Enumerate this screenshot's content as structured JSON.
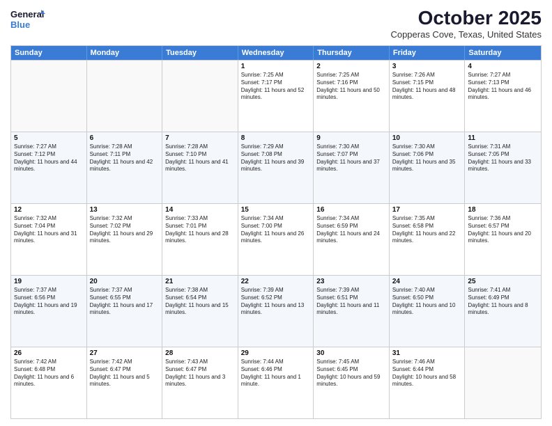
{
  "logo": {
    "line1": "General",
    "line2": "Blue"
  },
  "title": "October 2025",
  "subtitle": "Copperas Cove, Texas, United States",
  "days_of_week": [
    "Sunday",
    "Monday",
    "Tuesday",
    "Wednesday",
    "Thursday",
    "Friday",
    "Saturday"
  ],
  "weeks": [
    [
      {
        "day": "",
        "empty": true
      },
      {
        "day": "",
        "empty": true
      },
      {
        "day": "",
        "empty": true
      },
      {
        "day": "1",
        "sunrise": "Sunrise: 7:25 AM",
        "sunset": "Sunset: 7:17 PM",
        "daylight": "Daylight: 11 hours and 52 minutes."
      },
      {
        "day": "2",
        "sunrise": "Sunrise: 7:25 AM",
        "sunset": "Sunset: 7:16 PM",
        "daylight": "Daylight: 11 hours and 50 minutes."
      },
      {
        "day": "3",
        "sunrise": "Sunrise: 7:26 AM",
        "sunset": "Sunset: 7:15 PM",
        "daylight": "Daylight: 11 hours and 48 minutes."
      },
      {
        "day": "4",
        "sunrise": "Sunrise: 7:27 AM",
        "sunset": "Sunset: 7:13 PM",
        "daylight": "Daylight: 11 hours and 46 minutes."
      }
    ],
    [
      {
        "day": "5",
        "sunrise": "Sunrise: 7:27 AM",
        "sunset": "Sunset: 7:12 PM",
        "daylight": "Daylight: 11 hours and 44 minutes."
      },
      {
        "day": "6",
        "sunrise": "Sunrise: 7:28 AM",
        "sunset": "Sunset: 7:11 PM",
        "daylight": "Daylight: 11 hours and 42 minutes."
      },
      {
        "day": "7",
        "sunrise": "Sunrise: 7:28 AM",
        "sunset": "Sunset: 7:10 PM",
        "daylight": "Daylight: 11 hours and 41 minutes."
      },
      {
        "day": "8",
        "sunrise": "Sunrise: 7:29 AM",
        "sunset": "Sunset: 7:08 PM",
        "daylight": "Daylight: 11 hours and 39 minutes."
      },
      {
        "day": "9",
        "sunrise": "Sunrise: 7:30 AM",
        "sunset": "Sunset: 7:07 PM",
        "daylight": "Daylight: 11 hours and 37 minutes."
      },
      {
        "day": "10",
        "sunrise": "Sunrise: 7:30 AM",
        "sunset": "Sunset: 7:06 PM",
        "daylight": "Daylight: 11 hours and 35 minutes."
      },
      {
        "day": "11",
        "sunrise": "Sunrise: 7:31 AM",
        "sunset": "Sunset: 7:05 PM",
        "daylight": "Daylight: 11 hours and 33 minutes."
      }
    ],
    [
      {
        "day": "12",
        "sunrise": "Sunrise: 7:32 AM",
        "sunset": "Sunset: 7:04 PM",
        "daylight": "Daylight: 11 hours and 31 minutes."
      },
      {
        "day": "13",
        "sunrise": "Sunrise: 7:32 AM",
        "sunset": "Sunset: 7:02 PM",
        "daylight": "Daylight: 11 hours and 29 minutes."
      },
      {
        "day": "14",
        "sunrise": "Sunrise: 7:33 AM",
        "sunset": "Sunset: 7:01 PM",
        "daylight": "Daylight: 11 hours and 28 minutes."
      },
      {
        "day": "15",
        "sunrise": "Sunrise: 7:34 AM",
        "sunset": "Sunset: 7:00 PM",
        "daylight": "Daylight: 11 hours and 26 minutes."
      },
      {
        "day": "16",
        "sunrise": "Sunrise: 7:34 AM",
        "sunset": "Sunset: 6:59 PM",
        "daylight": "Daylight: 11 hours and 24 minutes."
      },
      {
        "day": "17",
        "sunrise": "Sunrise: 7:35 AM",
        "sunset": "Sunset: 6:58 PM",
        "daylight": "Daylight: 11 hours and 22 minutes."
      },
      {
        "day": "18",
        "sunrise": "Sunrise: 7:36 AM",
        "sunset": "Sunset: 6:57 PM",
        "daylight": "Daylight: 11 hours and 20 minutes."
      }
    ],
    [
      {
        "day": "19",
        "sunrise": "Sunrise: 7:37 AM",
        "sunset": "Sunset: 6:56 PM",
        "daylight": "Daylight: 11 hours and 19 minutes."
      },
      {
        "day": "20",
        "sunrise": "Sunrise: 7:37 AM",
        "sunset": "Sunset: 6:55 PM",
        "daylight": "Daylight: 11 hours and 17 minutes."
      },
      {
        "day": "21",
        "sunrise": "Sunrise: 7:38 AM",
        "sunset": "Sunset: 6:54 PM",
        "daylight": "Daylight: 11 hours and 15 minutes."
      },
      {
        "day": "22",
        "sunrise": "Sunrise: 7:39 AM",
        "sunset": "Sunset: 6:52 PM",
        "daylight": "Daylight: 11 hours and 13 minutes."
      },
      {
        "day": "23",
        "sunrise": "Sunrise: 7:39 AM",
        "sunset": "Sunset: 6:51 PM",
        "daylight": "Daylight: 11 hours and 11 minutes."
      },
      {
        "day": "24",
        "sunrise": "Sunrise: 7:40 AM",
        "sunset": "Sunset: 6:50 PM",
        "daylight": "Daylight: 11 hours and 10 minutes."
      },
      {
        "day": "25",
        "sunrise": "Sunrise: 7:41 AM",
        "sunset": "Sunset: 6:49 PM",
        "daylight": "Daylight: 11 hours and 8 minutes."
      }
    ],
    [
      {
        "day": "26",
        "sunrise": "Sunrise: 7:42 AM",
        "sunset": "Sunset: 6:48 PM",
        "daylight": "Daylight: 11 hours and 6 minutes."
      },
      {
        "day": "27",
        "sunrise": "Sunrise: 7:42 AM",
        "sunset": "Sunset: 6:47 PM",
        "daylight": "Daylight: 11 hours and 5 minutes."
      },
      {
        "day": "28",
        "sunrise": "Sunrise: 7:43 AM",
        "sunset": "Sunset: 6:47 PM",
        "daylight": "Daylight: 11 hours and 3 minutes."
      },
      {
        "day": "29",
        "sunrise": "Sunrise: 7:44 AM",
        "sunset": "Sunset: 6:46 PM",
        "daylight": "Daylight: 11 hours and 1 minute."
      },
      {
        "day": "30",
        "sunrise": "Sunrise: 7:45 AM",
        "sunset": "Sunset: 6:45 PM",
        "daylight": "Daylight: 10 hours and 59 minutes."
      },
      {
        "day": "31",
        "sunrise": "Sunrise: 7:46 AM",
        "sunset": "Sunset: 6:44 PM",
        "daylight": "Daylight: 10 hours and 58 minutes."
      },
      {
        "day": "",
        "empty": true
      }
    ]
  ]
}
